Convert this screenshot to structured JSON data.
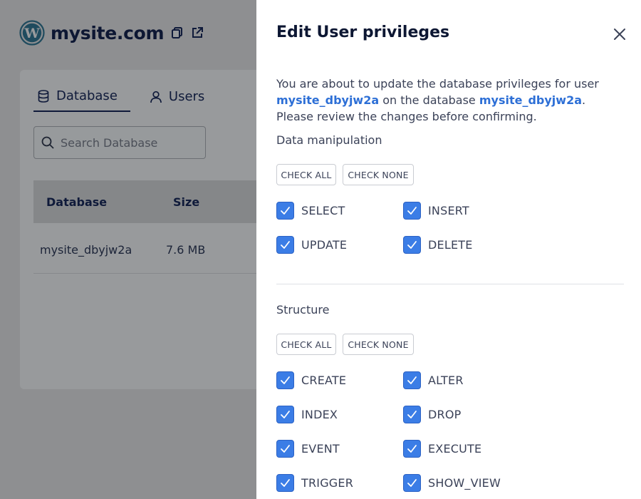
{
  "site": {
    "title": "mysite.com",
    "logo_icon": "wordpress-logo-icon"
  },
  "tabs": [
    {
      "label": "Database",
      "icon": "database-icon",
      "active": true
    },
    {
      "label": "Users",
      "icon": "user-icon",
      "active": false
    }
  ],
  "search": {
    "placeholder": "Search Database",
    "value": ""
  },
  "table": {
    "headers": [
      "Database",
      "Size"
    ],
    "rows": [
      [
        "mysite_dbyjw2a",
        "7.6 MB"
      ]
    ]
  },
  "modal": {
    "title": "Edit User privileges",
    "intro_prefix": "You are about to update the database privileges for user ",
    "user": "mysite_dbyjw2a",
    "intro_mid": " on the database ",
    "database": "mysite_dbyjw2a",
    "intro_suffix": ". Please review the changes before confirming.",
    "sections": [
      {
        "label": "Data manipulation",
        "check_all": "CHECK ALL",
        "check_none": "CHECK NONE",
        "privileges": [
          {
            "label": "SELECT",
            "checked": true
          },
          {
            "label": "INSERT",
            "checked": true
          },
          {
            "label": "UPDATE",
            "checked": true
          },
          {
            "label": "DELETE",
            "checked": true
          }
        ]
      },
      {
        "label": "Structure",
        "check_all": "CHECK ALL",
        "check_none": "CHECK NONE",
        "privileges": [
          {
            "label": "CREATE",
            "checked": true
          },
          {
            "label": "ALTER",
            "checked": true
          },
          {
            "label": "INDEX",
            "checked": true
          },
          {
            "label": "DROP",
            "checked": true
          },
          {
            "label": "EVENT",
            "checked": true
          },
          {
            "label": "EXECUTE",
            "checked": true
          },
          {
            "label": "TRIGGER",
            "checked": true
          },
          {
            "label": "SHOW_VIEW",
            "checked": true
          }
        ]
      }
    ]
  },
  "colors": {
    "accent": "#3b7de6",
    "link": "#2d6fd6",
    "overlay": "#8e8f91"
  }
}
